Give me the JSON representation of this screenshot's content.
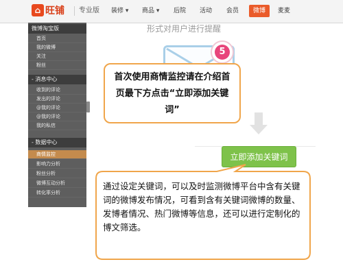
{
  "app": {
    "logo_icon": "home-logo-icon",
    "logo_glyph": "⌂",
    "logo_text": "旺铺",
    "edition": "专业版"
  },
  "nav": {
    "items": [
      "装修 ▾",
      "商品 ▾",
      "后院",
      "活动",
      "会员",
      "微博",
      "麦麦"
    ],
    "active": "微博",
    "active_color": "#ea5b2a"
  },
  "sidebar": {
    "sections": [
      {
        "title": "微博淘宝版",
        "items": [
          "首页",
          "我的微博",
          "关注",
          "粉丝"
        ]
      },
      {
        "title": "- 消息中心",
        "items": [
          "收到的评论",
          "发出的评论",
          "@我的评论",
          "@我的评论",
          "我的私信"
        ]
      },
      {
        "title": "- 数据中心",
        "items": [
          "商情监控",
          "影响力分析",
          "粉丝分析",
          "微博互动分析",
          "转化率分析"
        ]
      }
    ],
    "active_item": "商情监控",
    "active_color": "#c48b4d"
  },
  "main": {
    "faded_title": "形式对用户进行提醒",
    "step_number": "5",
    "instruction": "首次使用商情监控请在介绍首页最下方点击“立即添加关键词”",
    "cta_label": "立即添加关键词",
    "cta_color": "#7ec24a",
    "arrow_icon": "down-arrow-icon"
  },
  "callout": {
    "text": "通过设定关键词，可以及时监测微博平台中含有关键词的微博发布情况，可看到含有关键词微博的数量、发博者情况、热门微博等信息，还可以进行定制化的博文筛选。",
    "border_color": "#f0a54a"
  }
}
